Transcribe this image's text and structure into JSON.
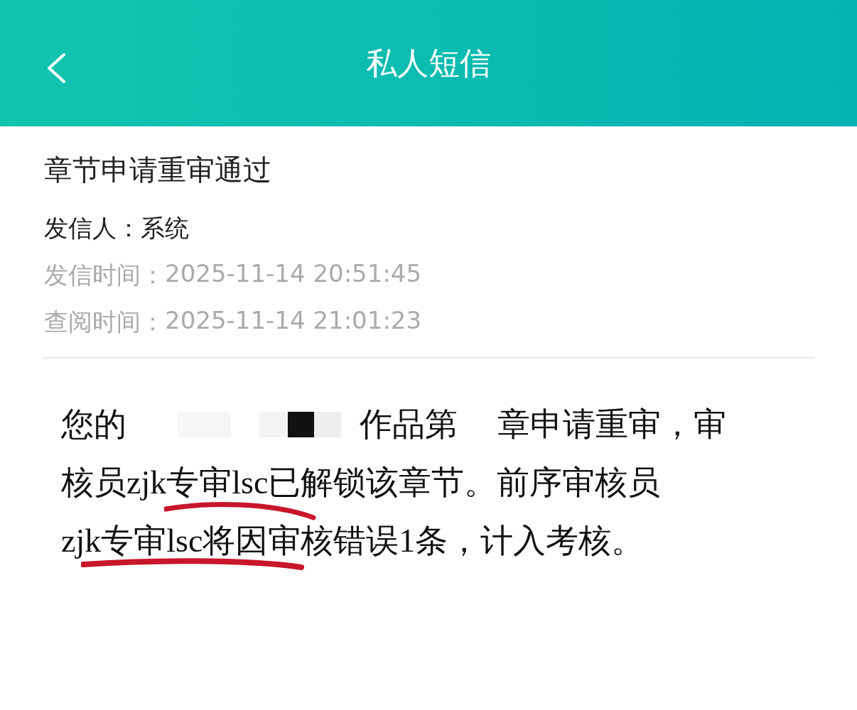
{
  "header": {
    "title": "私人短信"
  },
  "message": {
    "subject": "章节申请重审通过",
    "sender_label": "发信人：",
    "sender": "系统",
    "sent_label": "发信时间：",
    "sent_time": "2025-11-14 20:51:45",
    "read_label": "查阅时间：",
    "read_time": "2025-11-14 21:01:23",
    "body_lines": [
      [
        {
          "kind": "text",
          "text": "您的"
        },
        {
          "kind": "redaction"
        },
        {
          "kind": "text",
          "text": "作品第"
        },
        {
          "kind": "gap"
        },
        {
          "kind": "text",
          "text": "章申请重审，审"
        }
      ],
      [
        {
          "kind": "text",
          "text": "核员zjk专审lsc已解锁该章节。前序审核员"
        }
      ],
      [
        {
          "kind": "text",
          "text": "zjk专审lsc将因审核错误1条，计入考核。"
        }
      ]
    ]
  }
}
